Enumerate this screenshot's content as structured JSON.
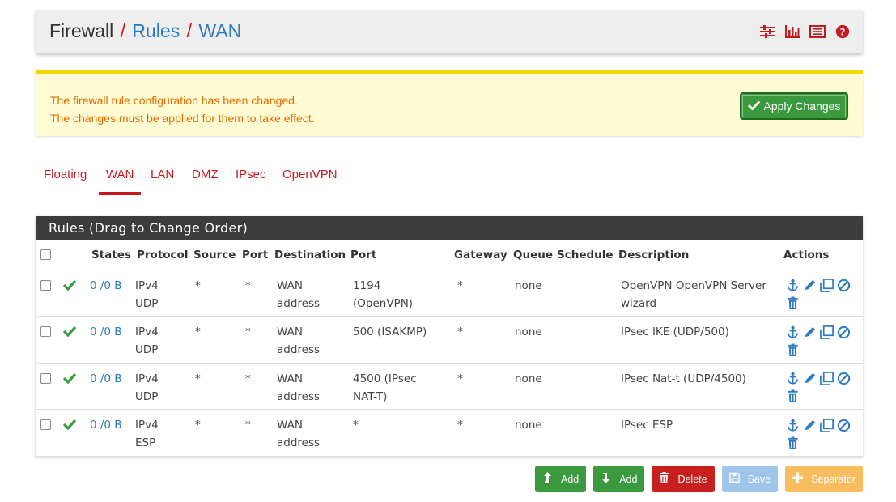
{
  "breadcrumb": {
    "root": "Firewall",
    "sep1": "/",
    "link1": "Rules",
    "sep2": "/",
    "link2": "WAN"
  },
  "header_icons": [
    "sliders-icon",
    "bar-chart-icon",
    "list-icon",
    "help-icon"
  ],
  "alert": {
    "line1": "The firewall rule configuration has been changed.",
    "line2": "The changes must be applied for them to take effect.",
    "apply_label": "Apply Changes"
  },
  "tabs": [
    {
      "label": "Floating",
      "active": false
    },
    {
      "label": "WAN",
      "active": true
    },
    {
      "label": "LAN",
      "active": false
    },
    {
      "label": "DMZ",
      "active": false
    },
    {
      "label": "IPsec",
      "active": false
    },
    {
      "label": "OpenVPN",
      "active": false
    }
  ],
  "panel": {
    "title": "Rules (Drag to Change Order)",
    "columns": [
      "States",
      "Protocol",
      "Source",
      "Port",
      "Destination",
      "Port",
      "Gateway",
      "Queue",
      "Schedule",
      "Description",
      "Actions"
    ],
    "rows": [
      {
        "states": "0 /0 B",
        "protocol": [
          "IPv4",
          "UDP"
        ],
        "source": "*",
        "port": "*",
        "destination": [
          "WAN",
          "address"
        ],
        "dport": [
          "1194",
          "(OpenVPN)"
        ],
        "gateway": "*",
        "queue": "none",
        "schedule": "",
        "description": [
          "OpenVPN OpenVPN Server",
          "wizard"
        ]
      },
      {
        "states": "0 /0 B",
        "protocol": [
          "IPv4",
          "UDP"
        ],
        "source": "*",
        "port": "*",
        "destination": [
          "WAN",
          "address"
        ],
        "dport": [
          "500 (ISAKMP)",
          ""
        ],
        "gateway": "*",
        "queue": "none",
        "schedule": "",
        "description": [
          "IPsec IKE (UDP/500)",
          ""
        ]
      },
      {
        "states": "0 /0 B",
        "protocol": [
          "IPv4",
          "UDP"
        ],
        "source": "*",
        "port": "*",
        "destination": [
          "WAN",
          "address"
        ],
        "dport": [
          "4500 (IPsec",
          "NAT-T)"
        ],
        "gateway": "*",
        "queue": "none",
        "schedule": "",
        "description": [
          "IPsec Nat-t (UDP/4500)",
          ""
        ]
      },
      {
        "states": "0 /0 B",
        "protocol": [
          "IPv4",
          "ESP"
        ],
        "source": "*",
        "port": "*",
        "destination": [
          "WAN",
          "address"
        ],
        "dport": [
          "*",
          ""
        ],
        "gateway": "*",
        "queue": "none",
        "schedule": "",
        "description": [
          "IPsec ESP",
          ""
        ]
      }
    ]
  },
  "buttons": {
    "add_top": "Add",
    "add_bottom": "Add",
    "delete": "Delete",
    "save": "Save",
    "separator": "Separator"
  },
  "colors": {
    "accent": "#c4191f",
    "link": "#2a7bbf",
    "success": "#3b9a3d",
    "alert_bg": "#fffcd3",
    "alert_text": "#e06a00"
  }
}
